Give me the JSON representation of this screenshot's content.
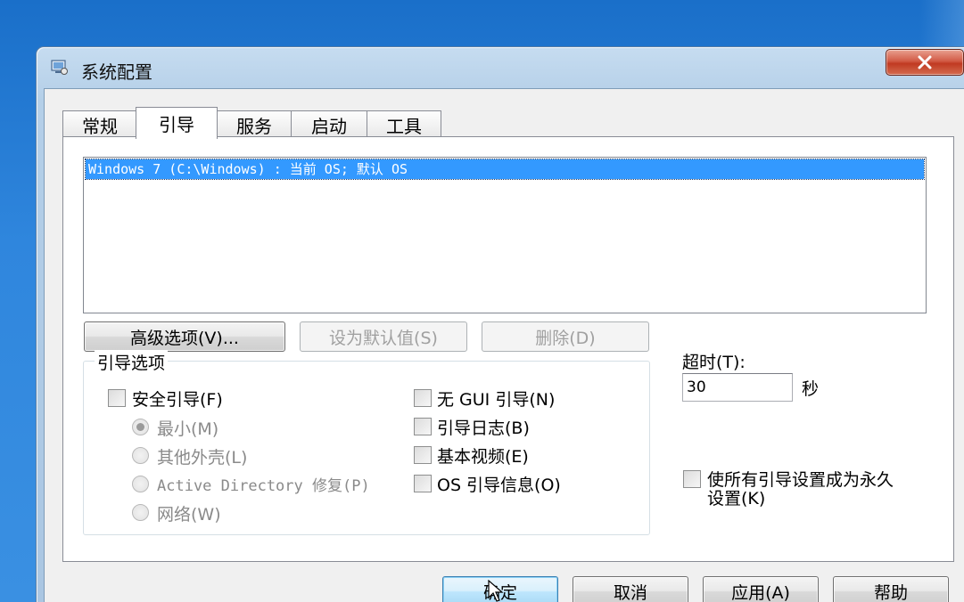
{
  "window": {
    "title": "系统配置",
    "close_label": "x"
  },
  "tabs": [
    {
      "label": "常规",
      "active": false
    },
    {
      "label": "引导",
      "active": true
    },
    {
      "label": "服务",
      "active": false
    },
    {
      "label": "启动",
      "active": false
    },
    {
      "label": "工具",
      "active": false
    }
  ],
  "boot_list": {
    "items": [
      "Windows 7 (C:\\Windows) : 当前 OS; 默认 OS"
    ]
  },
  "buttons": {
    "advanced": "高级选项(V)...",
    "set_default": "设为默认值(S)",
    "delete": "删除(D)"
  },
  "boot_options": {
    "title": "引导选项",
    "safe_boot": "安全引导(F)",
    "minimal": "最小(M)",
    "alternate_shell": "其他外壳(L)",
    "ad_repair": "Active Directory 修复(P)",
    "network": "网络(W)",
    "no_gui": "无 GUI 引导(N)",
    "boot_log": "引导日志(B)",
    "base_video": "基本视频(E)",
    "os_info": "OS 引导信息(O)"
  },
  "timeout": {
    "label": "超时(T):",
    "value": "30",
    "unit": "秒"
  },
  "permanent": {
    "line1": "使所有引导设置成为永久",
    "line2": "设置(K)"
  },
  "footer": {
    "ok": "确定",
    "cancel": "取消",
    "apply": "应用(A)",
    "help": "帮助"
  }
}
